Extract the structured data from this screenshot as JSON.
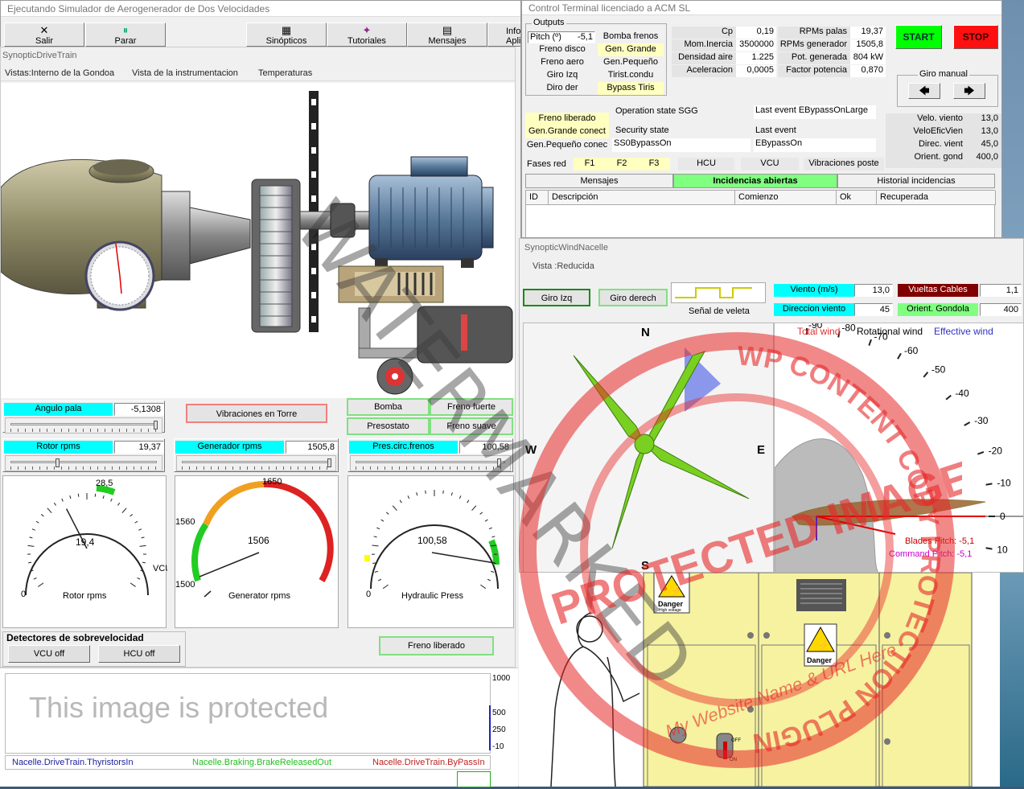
{
  "main": {
    "title": "Ejecutando Simulador de Aerogenerador de Dos Velocidades",
    "toolbar": [
      {
        "label": "Salir",
        "icon": "✕"
      },
      {
        "label": "Parar",
        "icon": "⏸"
      },
      {
        "label": "Sinópticos",
        "icon": "▦"
      },
      {
        "label": "Tutoriales",
        "icon": "✦"
      },
      {
        "label": "Mensajes",
        "icon": "▤"
      },
      {
        "label": "Infor Apli",
        "icon": ""
      }
    ]
  },
  "drivetrain": {
    "title": "SynopticDriveTrain",
    "menu": [
      "Vistas:Interno de la Gondoa",
      "Vista de la instrumentacion",
      "Temperaturas"
    ],
    "angulo_pala": {
      "label": "Angulo pala",
      "value": "-5,1308",
      "slider": 0.98
    },
    "vibraciones_btn": "Vibraciones en Torre",
    "bomba_btn": "Bomba",
    "freno_fuerte_btn": "Freno fuerte",
    "presostato_btn": "Presostato",
    "freno_suave_btn": "Freno suave",
    "rotor": {
      "label": "Rotor rpms",
      "value": "19,37",
      "slider": 0.35
    },
    "generador": {
      "label": "Generador rpms",
      "value": "1505,8",
      "slider": 0.98
    },
    "pres": {
      "label": "Pres.circ.frenos",
      "value": "100,58",
      "slider": 0.95
    },
    "gauge_rotor": {
      "caption": "Rotor rpms",
      "value": "19,4",
      "zero": "0",
      "mark": "28,5",
      "side": "VCU",
      "needle": 0.4
    },
    "gauge_gen": {
      "caption": "Generator rpms",
      "value": "1506",
      "min": "1500",
      "low": "1560",
      "high": "1650",
      "needle": 0.12
    },
    "gauge_hyd": {
      "caption": "Hydraulic Press",
      "value": "100,58",
      "zero": "0",
      "needle": 0.93
    },
    "detectores_title": "Detectores de sobrevelocidad",
    "vcu_off": "VCU off",
    "hcu_off": "HCU off",
    "freno_liberado_btn": "Freno liberado"
  },
  "trend": {
    "protected_text": "This image is protected",
    "y_ticks": [
      "1000",
      "500",
      "250",
      "-10"
    ],
    "legend": [
      "Nacelle.DriveTrain.ThyristorsIn",
      "Nacelle.Braking.BrakeReleasedOut",
      "Nacelle.DriveTrain.ByPassIn"
    ]
  },
  "terminal": {
    "title": "Control Terminal licenciado a ACM SL",
    "outputs_label": "Outputs",
    "pitch_label": "Pitch (º)",
    "pitch_value": "-5,1",
    "left_items": [
      "Freno disco",
      "Freno aero",
      "Giro Izq",
      "Diro der"
    ],
    "right_items": [
      {
        "t": "Bomba frenos",
        "on": false
      },
      {
        "t": "Gen. Grande",
        "on": true
      },
      {
        "t": "Gen.Pequeño",
        "on": false
      },
      {
        "t": "Tirist.condu",
        "on": false
      },
      {
        "t": "Bypass Tiris",
        "on": true
      }
    ],
    "params": [
      {
        "l": "Cp",
        "v": "0,19"
      },
      {
        "l": "Mom.Inercia",
        "v": "3500000"
      },
      {
        "l": "Densidad aire",
        "v": "1.225"
      },
      {
        "l": "Aceleracion",
        "v": "0,0005"
      }
    ],
    "params2": [
      {
        "l": "RPMs palas",
        "v": "19,37"
      },
      {
        "l": "RPMs generador",
        "v": "1505,8"
      },
      {
        "l": "Pot. generada",
        "v": "804 kW"
      },
      {
        "l": "Factor potencia",
        "v": "0,870"
      }
    ],
    "start": "START",
    "stop": "STOP",
    "giro_manual": "Giro manual",
    "status_left": [
      "Freno liberado",
      "Gen.Grande conect",
      "Gen.Pequeño conec"
    ],
    "op_state_label": "Operation state SGG",
    "security_label": "Security state",
    "security_value": "SS0BypassOn",
    "last_event_label": "Last event EBypassOnLarge",
    "last_event2_label": "Last event",
    "last_event2_value": "EBypassOn",
    "wind": [
      {
        "l": "Velo. viento",
        "v": "13,0"
      },
      {
        "l": "VeloEficVien",
        "v": "13,0"
      },
      {
        "l": "Direc. vient",
        "v": "45,0"
      },
      {
        "l": "Orient. gond",
        "v": "400,0"
      }
    ],
    "fases_label": "Fases red",
    "fases": [
      "F1",
      "F2",
      "F3"
    ],
    "hcu": "HCU",
    "vcu": "VCU",
    "vib_poste": "Vibraciones poste",
    "tabs": [
      "Mensajes",
      "Incidencias abiertas",
      "Historial incidencias"
    ],
    "cols": [
      "ID",
      "Descripción",
      "Comienzo",
      "Ok",
      "Recuperada"
    ]
  },
  "nacelle": {
    "title": "SynopticWindNacelle",
    "vista": "Vista   :Reducida",
    "giro_izq": "Giro Izq",
    "giro_der": "Giro derech",
    "veleta": "Señal de veleta",
    "viento_label": "Viento (m/s)",
    "viento_value": "13,0",
    "direccion_label": "Direccion viento",
    "direccion_value": "45",
    "vueltas_label": "Vueltas Cables",
    "vueltas_value": "1,1",
    "orient_label": "Orient. Gondola",
    "orient_value": "400",
    "compass": [
      "N",
      "W",
      "E",
      "S"
    ],
    "legend": [
      {
        "t": "Total wind",
        "c": "#e03030"
      },
      {
        "t": "Rotational wind",
        "c": "#000000"
      },
      {
        "t": "Effective wind",
        "c": "#3030c0"
      }
    ],
    "angle_labels": [
      "-90",
      "-80",
      "-70",
      "-60",
      "-50",
      "-40",
      "-30",
      "-20",
      "-10",
      "0",
      "10"
    ],
    "blades_pitch": "Blades Pitch: -5,1",
    "command_pitch": "Command Pitch: -5,1"
  },
  "cabinet": {
    "danger1": "Danger",
    "danger1_sub": "High voltage",
    "danger2": "Danger",
    "off": "OFF",
    "on": "ON"
  },
  "watermark": {
    "main": "WATERMARKED",
    "ring": "WP CONTENT COPY PROTECTION PLUGIN",
    "center": "PROTECTED IMAGE",
    "url": "My Website Name & URL Here"
  }
}
